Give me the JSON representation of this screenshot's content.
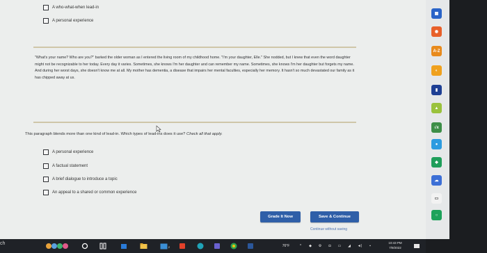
{
  "top_options": [
    {
      "label": "A who-what-when lead-in"
    },
    {
      "label": "A personal experience"
    }
  ],
  "passage": "\"What's your name? Who are you?\" barked the older woman as I entered the living room of my childhood home. \"I'm your daughter, Elle.\" She nodded, but I knew that even the word daughter might not be recognizable to her today. Every day it varies. Sometimes, she knows I'm her daughter and can remember my name. Sometimes, she knows I'm her daughter but forgets my name. And during her worst days, she doesn't know me at all. My mother has dementia, a disease that impairs her mental faculties, especially her memory. It hasn't so much devastated our family as it has chipped away at us.",
  "question": {
    "text": "This paragraph blends more than one kind of lead-in. Which types of lead-ins does it use?",
    "instruction": "Check all that apply."
  },
  "options": [
    {
      "label": "A personal experience"
    },
    {
      "label": "A factual statement"
    },
    {
      "label": "A brief dialogue to introduce a topic"
    },
    {
      "label": "An appeal to a shared or common experience"
    }
  ],
  "buttons": {
    "grade": "Grade It Now",
    "save": "Save & Continue",
    "continue_without": "Continue without saving"
  },
  "dock": [
    {
      "icon": "calendar-app-icon",
      "color": "#2a64c8",
      "glyph": "▦"
    },
    {
      "icon": "rss-icon",
      "color": "#e8602a",
      "glyph": "◉"
    },
    {
      "icon": "dictionary-icon",
      "color": "#e88a1c",
      "glyph": "A-Z"
    },
    {
      "icon": "settings-app-icon",
      "color": "#f0a11e",
      "glyph": "◐"
    },
    {
      "icon": "book-icon",
      "color": "#1e3f94",
      "glyph": "▮"
    },
    {
      "icon": "gallery-icon",
      "color": "#9ac23c",
      "glyph": "▲"
    },
    {
      "icon": "formula-icon",
      "color": "#3d8e47",
      "glyph": "√x"
    },
    {
      "icon": "globe-icon",
      "color": "#2c9be0",
      "glyph": "●"
    },
    {
      "icon": "drive-icon",
      "color": "#1f9e5a",
      "glyph": "◆"
    },
    {
      "icon": "weather-icon",
      "color": "#3c6fd6",
      "glyph": "☁"
    },
    {
      "icon": "notes-icon",
      "color": "#f2f2f2",
      "glyph": "▭"
    },
    {
      "icon": "circle-app-icon",
      "color": "#1da25a",
      "glyph": "○"
    }
  ],
  "taskbar": {
    "left_text": "ch",
    "temperature": "76°F",
    "clock_time": "10:43 PM",
    "clock_date": "7/9/2022",
    "badge_count": "2"
  },
  "colors": {
    "accent": "#2f5fa8",
    "link": "#4c72b0",
    "rule": "#cfc6a8"
  }
}
